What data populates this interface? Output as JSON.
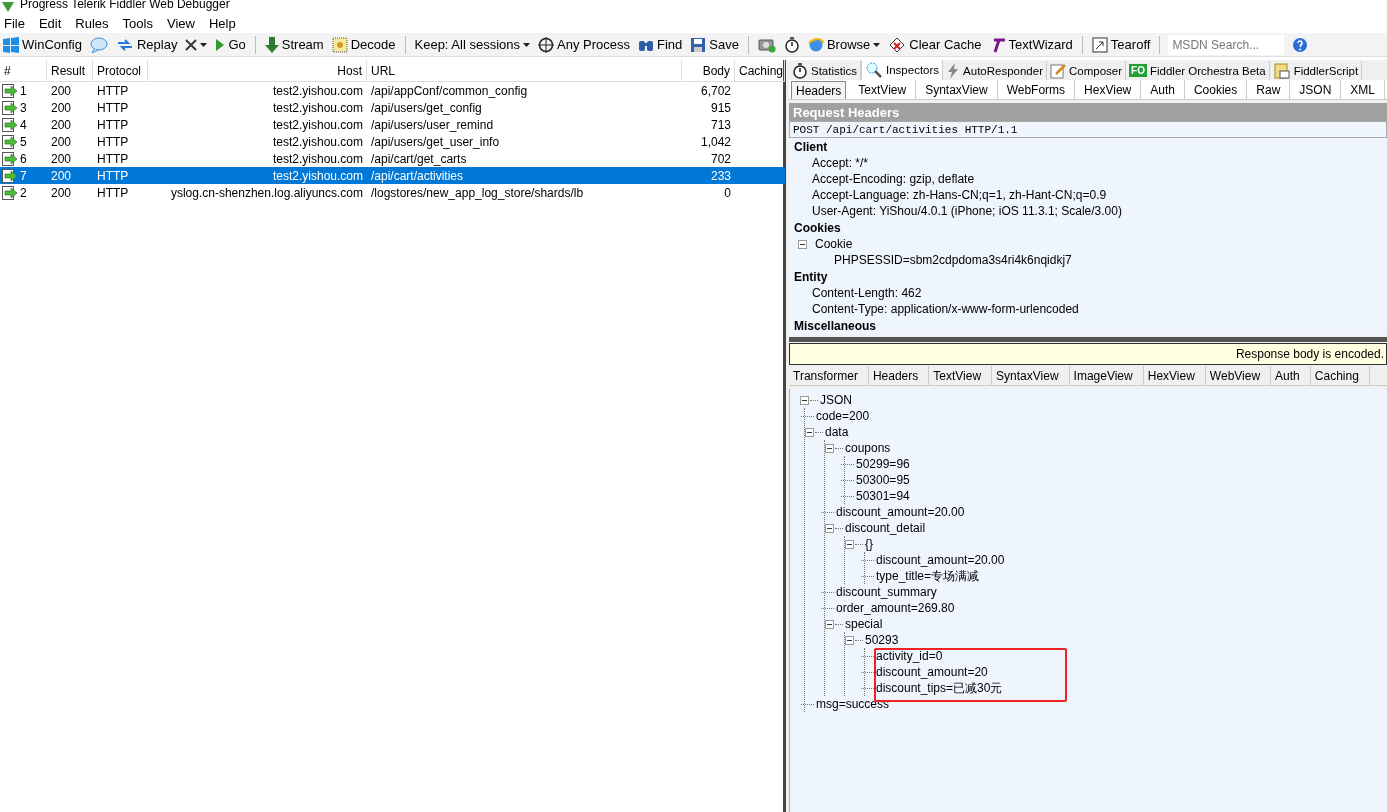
{
  "window": {
    "title": "Progress Telerik Fiddler Web Debugger"
  },
  "menu": [
    "File",
    "Edit",
    "Rules",
    "Tools",
    "View",
    "Help"
  ],
  "toolbar": [
    {
      "kind": "button",
      "label": "WinConfig",
      "dropdown": false
    },
    {
      "kind": "button",
      "dropdown": false
    },
    {
      "kind": "button",
      "label": "Replay",
      "dropdown": false
    },
    {
      "kind": "button",
      "dropdown": true
    },
    {
      "kind": "button",
      "label": "Go",
      "dropdown": false
    },
    {
      "kind": "separator"
    },
    {
      "kind": "button",
      "label": "Stream",
      "dropdown": false
    },
    {
      "kind": "button",
      "label": "Decode",
      "dropdown": false
    },
    {
      "kind": "separator"
    },
    {
      "kind": "button",
      "label": "Keep: All sessions",
      "dropdown": true
    },
    {
      "kind": "button",
      "label": "Any Process",
      "dropdown": false
    },
    {
      "kind": "button",
      "label": "Find",
      "dropdown": false
    },
    {
      "kind": "button",
      "label": "Save",
      "dropdown": false
    },
    {
      "kind": "separator"
    },
    {
      "kind": "button",
      "dropdown": false
    },
    {
      "kind": "button",
      "dropdown": false
    },
    {
      "kind": "button",
      "label": "Browse",
      "dropdown": true
    },
    {
      "kind": "button",
      "label": "Clear Cache",
      "dropdown": false
    },
    {
      "kind": "button",
      "label": "TextWizard",
      "dropdown": false
    },
    {
      "kind": "separator"
    },
    {
      "kind": "button",
      "label": "Tearoff",
      "dropdown": false
    }
  ],
  "search": {
    "placeholder": "MSDN Search..."
  },
  "sessions": {
    "columns": [
      "#",
      "Result",
      "Protocol",
      "Host",
      "URL",
      "Body",
      "Caching"
    ],
    "rows": [
      {
        "id": "1",
        "result": "200",
        "protocol": "HTTP",
        "host": "test2.yishou.com",
        "url": "/api/appConf/common_config",
        "body": "6,702",
        "selected": false
      },
      {
        "id": "3",
        "result": "200",
        "protocol": "HTTP",
        "host": "test2.yishou.com",
        "url": "/api/users/get_config",
        "body": "915",
        "selected": false
      },
      {
        "id": "4",
        "result": "200",
        "protocol": "HTTP",
        "host": "test2.yishou.com",
        "url": "/api/users/user_remind",
        "body": "713",
        "selected": false
      },
      {
        "id": "5",
        "result": "200",
        "protocol": "HTTP",
        "host": "test2.yishou.com",
        "url": "/api/users/get_user_info",
        "body": "1,042",
        "selected": false
      },
      {
        "id": "6",
        "result": "200",
        "protocol": "HTTP",
        "host": "test2.yishou.com",
        "url": "/api/cart/get_carts",
        "body": "702",
        "selected": false
      },
      {
        "id": "7",
        "result": "200",
        "protocol": "HTTP",
        "host": "test2.yishou.com",
        "url": "/api/cart/activities",
        "body": "233",
        "selected": true
      },
      {
        "id": "2",
        "result": "200",
        "protocol": "HTTP",
        "host": "yslog.cn-shenzhen.log.aliyuncs.com",
        "url": "/logstores/new_app_log_store/shards/lb",
        "body": "0",
        "selected": false
      }
    ]
  },
  "tabs": [
    {
      "label": "Statistics",
      "selected": false
    },
    {
      "label": "Inspectors",
      "selected": true
    },
    {
      "label": "AutoResponder",
      "selected": false
    },
    {
      "label": "Composer",
      "selected": false
    },
    {
      "label": "Fiddler Orchestra Beta",
      "selected": false
    },
    {
      "label": "FiddlerScript",
      "selected": false
    }
  ],
  "fo_badge": "FO",
  "request_tabs": [
    {
      "label": "Headers",
      "selected": true
    },
    {
      "label": "TextView",
      "selected": false
    },
    {
      "label": "SyntaxView",
      "selected": false
    },
    {
      "label": "WebForms",
      "selected": false
    },
    {
      "label": "HexView",
      "selected": false
    },
    {
      "label": "Auth",
      "selected": false
    },
    {
      "label": "Cookies",
      "selected": false
    },
    {
      "label": "Raw",
      "selected": false
    },
    {
      "label": "JSON",
      "selected": false
    },
    {
      "label": "XML",
      "selected": false
    }
  ],
  "request_headers": {
    "title": "Request Headers",
    "request_line": "POST /api/cart/activities HTTP/1.1",
    "groups": [
      {
        "name": "Client",
        "items": [
          {
            "text": "Accept: */*"
          },
          {
            "text": "Accept-Encoding: gzip, deflate"
          },
          {
            "text": "Accept-Language: zh-Hans-CN;q=1, zh-Hant-CN;q=0.9"
          },
          {
            "text": "User-Agent: YiShou/4.0.1 (iPhone; iOS 11.3.1; Scale/3.00)"
          }
        ]
      },
      {
        "name": "Cookies",
        "items": [
          {
            "text": "Cookie",
            "expanded": true,
            "children": [
              {
                "text": "PHPSESSID=sbm2cdpdoma3s4ri4k6nqidkj7"
              }
            ]
          }
        ]
      },
      {
        "name": "Entity",
        "items": [
          {
            "text": "Content-Length: 462"
          },
          {
            "text": "Content-Type: application/x-www-form-urlencoded"
          }
        ]
      },
      {
        "name": "Miscellaneous"
      }
    ]
  },
  "notice": "Response body is encoded.",
  "response_tabs": [
    {
      "label": "Transformer",
      "selected": false
    },
    {
      "label": "Headers",
      "selected": false
    },
    {
      "label": "TextView",
      "selected": false
    },
    {
      "label": "SyntaxView",
      "selected": false
    },
    {
      "label": "ImageView",
      "selected": false
    },
    {
      "label": "HexView",
      "selected": false
    },
    {
      "label": "WebView",
      "selected": false
    },
    {
      "label": "Auth",
      "selected": false
    },
    {
      "label": "Caching",
      "selected": false
    }
  ],
  "json_tree": [
    {
      "label": "JSON",
      "expanded": true,
      "children": [
        {
          "label": "code=200"
        },
        {
          "label": "data",
          "expanded": true,
          "children": [
            {
              "label": "coupons",
              "expanded": true,
              "children": [
                {
                  "label": "50299=96"
                },
                {
                  "label": "50300=95"
                },
                {
                  "label": "50301=94"
                }
              ]
            },
            {
              "label": "discount_amount=20.00"
            },
            {
              "label": "discount_detail",
              "expanded": true,
              "children": [
                {
                  "label": "{}",
                  "expanded": true,
                  "children": [
                    {
                      "label": "discount_amount=20.00"
                    },
                    {
                      "label": "type_title=专场满减"
                    }
                  ]
                }
              ]
            },
            {
              "label": "discount_summary"
            },
            {
              "label": "order_amount=269.80"
            },
            {
              "label": "special",
              "expanded": true,
              "children": [
                {
                  "label": "50293",
                  "expanded": true,
                  "children": [
                    {
                      "label": "activity_id=0"
                    },
                    {
                      "label": "discount_amount=20"
                    },
                    {
                      "label": "discount_tips=已减30元"
                    }
                  ]
                }
              ]
            }
          ]
        },
        {
          "label": "msg=success"
        }
      ]
    }
  ],
  "annotation": {
    "kind": "highlight-box"
  }
}
